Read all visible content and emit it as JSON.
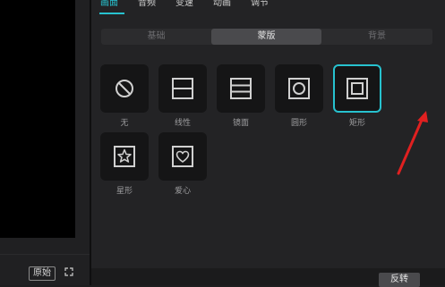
{
  "tabs": [
    "画面",
    "音频",
    "变速",
    "动画",
    "调节"
  ],
  "subtabs": [
    "基础",
    "蒙版",
    "背景"
  ],
  "masks": [
    {
      "label": "无",
      "icon": "no-mask-icon"
    },
    {
      "label": "线性",
      "icon": "linear-mask-icon"
    },
    {
      "label": "镜面",
      "icon": "mirror-mask-icon"
    },
    {
      "label": "圆形",
      "icon": "circle-mask-icon"
    },
    {
      "label": "矩形",
      "icon": "rectangle-mask-icon"
    },
    {
      "label": "星形",
      "icon": "star-mask-icon"
    },
    {
      "label": "爱心",
      "icon": "heart-mask-icon"
    }
  ],
  "preview": {
    "original_label": "原始"
  },
  "footer": {
    "reverse_label": "反转"
  },
  "colors": {
    "accent": "#27c2cf",
    "arrow": "#e02020"
  }
}
